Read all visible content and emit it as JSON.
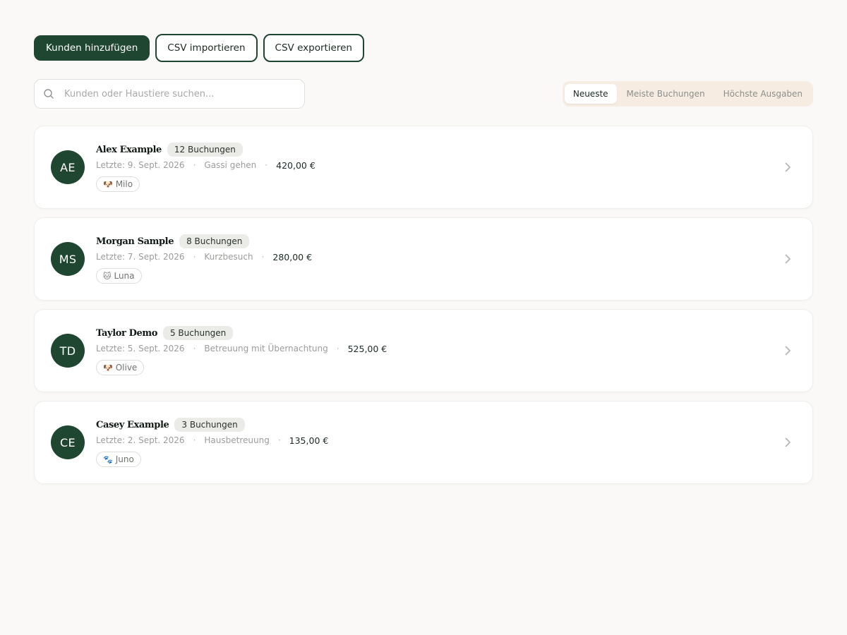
{
  "toolbar": {
    "add_label": "Kunden hinzufügen",
    "import_label": "CSV importieren",
    "export_label": "CSV exportieren"
  },
  "search": {
    "placeholder": "Kunden oder Haustiere suchen...",
    "value": ""
  },
  "sort": {
    "tabs": [
      {
        "label": "Neueste",
        "active": true
      },
      {
        "label": "Meiste Buchungen",
        "active": false
      },
      {
        "label": "Höchste Ausgaben",
        "active": false
      }
    ]
  },
  "clients": [
    {
      "initials": "AE",
      "name": "Alex Example",
      "bookings": "12 Buchungen",
      "last": "Letzte: 9. Sept. 2026",
      "service": "Gassi gehen",
      "amount": "420,00 €",
      "pet_icon": "🐶",
      "pet_name": "Milo"
    },
    {
      "initials": "MS",
      "name": "Morgan Sample",
      "bookings": "8 Buchungen",
      "last": "Letzte: 7. Sept. 2026",
      "service": "Kurzbesuch",
      "amount": "280,00 €",
      "pet_icon": "🐱",
      "pet_name": "Luna"
    },
    {
      "initials": "TD",
      "name": "Taylor Demo",
      "bookings": "5 Buchungen",
      "last": "Letzte: 5. Sept. 2026",
      "service": "Betreuung mit Übernachtung",
      "amount": "525,00 €",
      "pet_icon": "🐶",
      "pet_name": "Olive"
    },
    {
      "initials": "CE",
      "name": "Casey Example",
      "bookings": "3 Buchungen",
      "last": "Letzte: 2. Sept. 2026",
      "service": "Hausbetreuung",
      "amount": "135,00 €",
      "pet_icon": "🐾",
      "pet_name": "Juno"
    }
  ],
  "separator": "·",
  "colors": {
    "brand": "#1f4631",
    "background": "#faf9f7",
    "sort_bg": "#f6ece2"
  }
}
